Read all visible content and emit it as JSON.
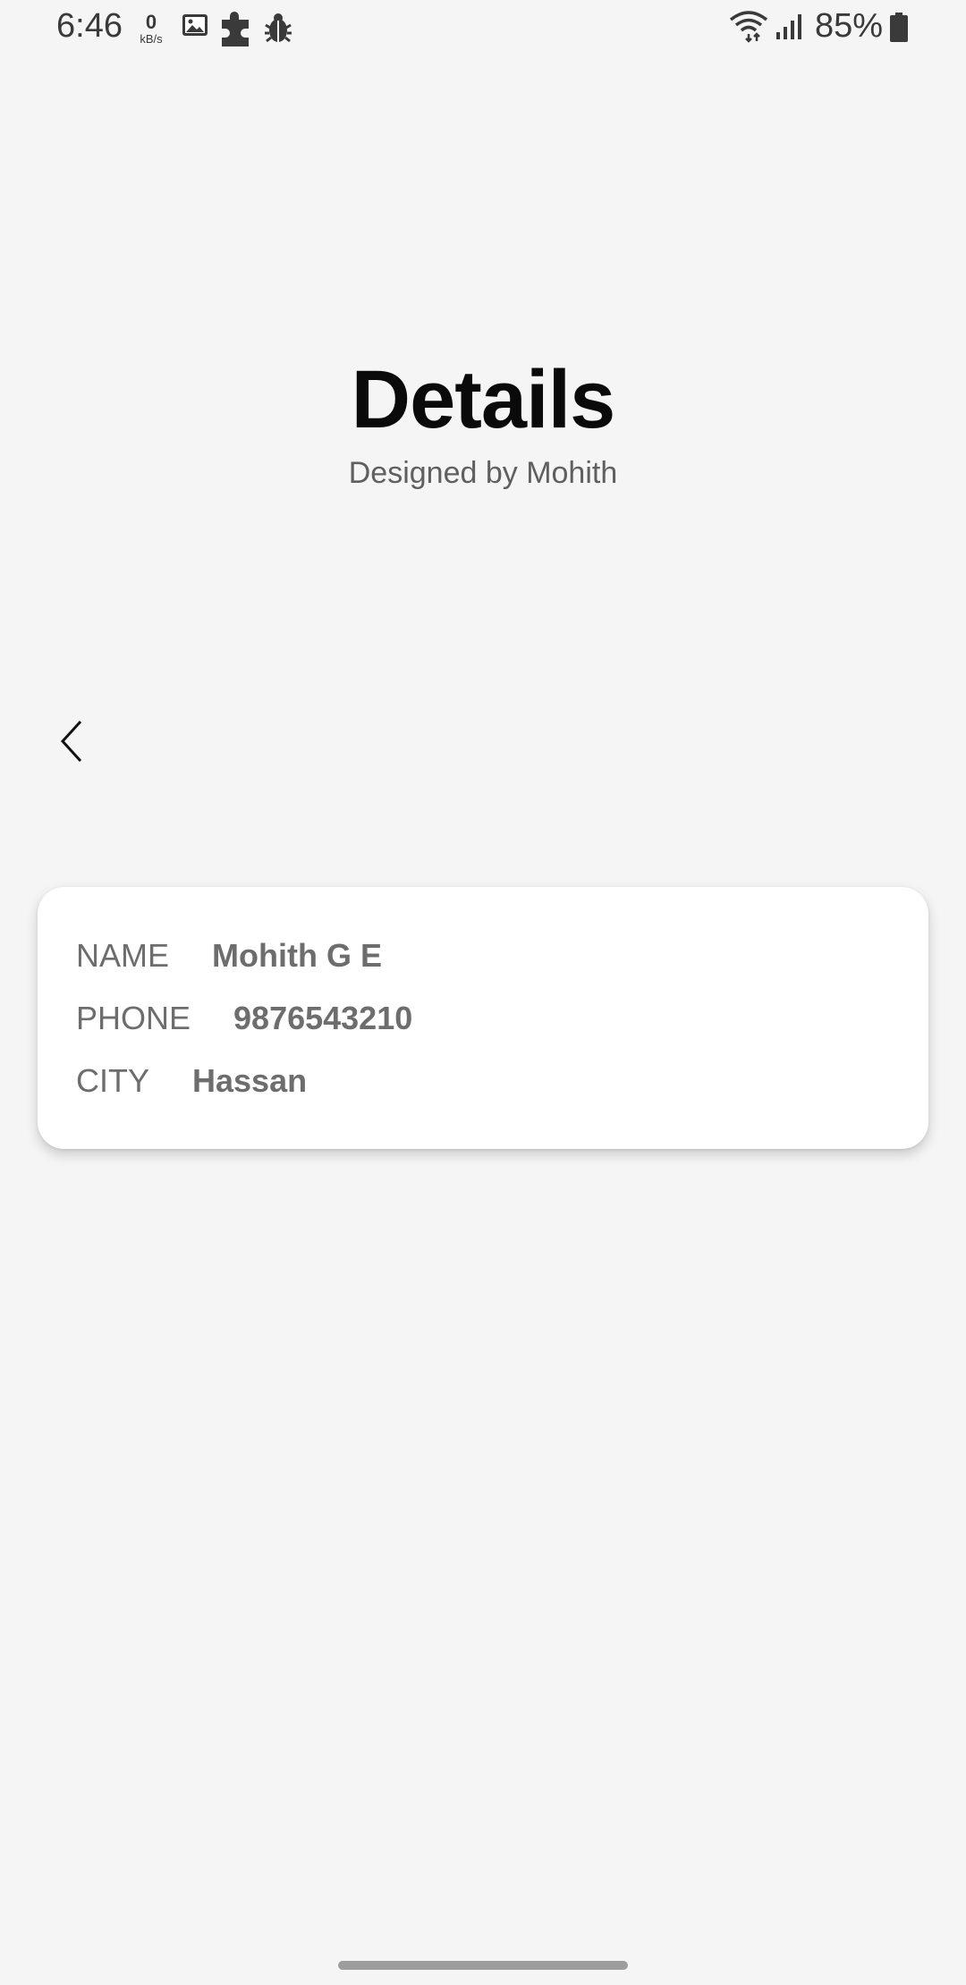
{
  "status_bar": {
    "time": "6:46",
    "net_speed_value": "0",
    "net_speed_unit": "kB/s",
    "battery": "85%",
    "icons": [
      "gallery-icon",
      "puzzle-icon",
      "bug-icon",
      "wifi-icon",
      "signal-icon",
      "battery-icon"
    ]
  },
  "header": {
    "title": "Details",
    "subtitle": "Designed by Mohith"
  },
  "nav": {
    "back_icon": "chevron-left-icon"
  },
  "details": {
    "name_label": "NAME",
    "name_value": "Mohith G E",
    "phone_label": "PHONE",
    "phone_value": "9876543210",
    "city_label": "CITY",
    "city_value": "Hassan"
  },
  "colors": {
    "background": "#f5f5f5",
    "card": "#ffffff",
    "title": "#0a0a0a",
    "text_muted": "#6d6d6d"
  }
}
